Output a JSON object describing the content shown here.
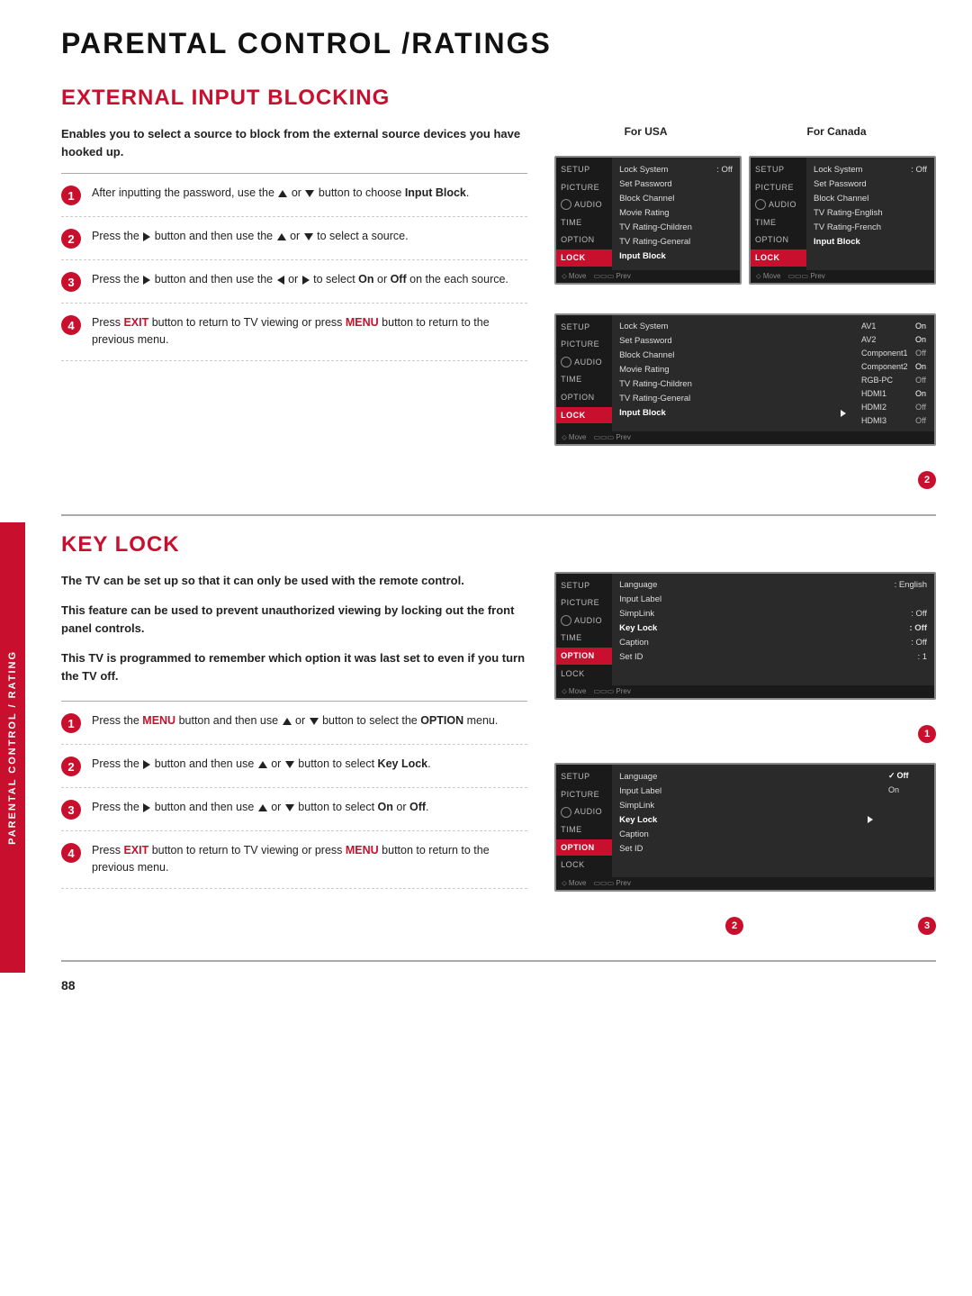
{
  "page": {
    "title": "PARENTAL CONTROL /RATINGS",
    "page_number": "88",
    "sidebar_label": "PARENTAL CONTROL / RATING"
  },
  "external_input_blocking": {
    "section_title": "EXTERNAL INPUT BLOCKING",
    "intro_text": "Enables you to select a source to block from the external source devices you have hooked up.",
    "steps": [
      {
        "num": "1",
        "text_parts": [
          "After inputting the password, use the ",
          "▲",
          " or ",
          "▼",
          " button to choose ",
          "Input Block",
          "."
        ]
      },
      {
        "num": "2",
        "text_parts": [
          "Press the ",
          "▶",
          " button and then use the ",
          "▲",
          " or ",
          "▼",
          " to select a source."
        ]
      },
      {
        "num": "3",
        "text_parts": [
          "Press the ",
          "▶",
          " button and then use the ",
          "◀",
          " or ",
          "▶",
          " to select ",
          "On",
          " or ",
          "Off",
          " on the each source."
        ]
      },
      {
        "num": "4",
        "text_parts": [
          "Press ",
          "EXIT",
          " button to return to TV viewing or press ",
          "MENU",
          " button to return to the previous menu."
        ]
      }
    ],
    "for_usa_label": "For USA",
    "for_canada_label": "For Canada",
    "menu_usa_items": [
      {
        "label": "Lock System",
        "value": ": Off"
      },
      {
        "label": "Set Password",
        "value": ""
      },
      {
        "label": "Block Channel",
        "value": ""
      },
      {
        "label": "Movie Rating",
        "value": ""
      },
      {
        "label": "TV Rating-Children",
        "value": ""
      },
      {
        "label": "TV Rating-General",
        "value": ""
      },
      {
        "label": "Input Block",
        "value": ""
      }
    ],
    "menu_canada_items": [
      {
        "label": "Lock System",
        "value": ": Off"
      },
      {
        "label": "Set Password",
        "value": ""
      },
      {
        "label": "Block Channel",
        "value": ""
      },
      {
        "label": "TV Rating-English",
        "value": ""
      },
      {
        "label": "TV Rating-French",
        "value": ""
      },
      {
        "label": "Input Block",
        "value": ""
      }
    ],
    "menu_sub_items": [
      {
        "label": "AV1",
        "value": "On",
        "state": "on"
      },
      {
        "label": "AV2",
        "value": "On",
        "state": "on"
      },
      {
        "label": "Component1",
        "value": "Off",
        "state": "off"
      },
      {
        "label": "Component2",
        "value": "On",
        "state": "on"
      },
      {
        "label": "RGB-PC",
        "value": "Off",
        "state": "off"
      },
      {
        "label": "HDMI1",
        "value": "On",
        "state": "on"
      },
      {
        "label": "HDMI2",
        "value": "Off",
        "state": "off"
      },
      {
        "label": "HDMI3",
        "value": "Off",
        "state": "off"
      }
    ],
    "menu_sidebar_items": [
      "SETUP",
      "PICTURE",
      "AUDIO",
      "TIME",
      "OPTION",
      "LOCK"
    ],
    "badge2": "2"
  },
  "key_lock": {
    "section_title": "KEY LOCK",
    "desc_lines": [
      "The TV can be set up so that it can only be used with the remote control.",
      "This feature can be used to prevent unauthorized viewing by locking out the front panel controls.",
      "This TV is programmed to remember which option it was last set to even if you turn the TV off."
    ],
    "steps": [
      {
        "num": "1",
        "text_parts": [
          "Press the ",
          "MENU",
          " button and then use ",
          "▲",
          " or ",
          "▼",
          " button to select the ",
          "OPTION",
          " menu."
        ]
      },
      {
        "num": "2",
        "text_parts": [
          "Press the ",
          "▶",
          " button and then use ",
          "▲",
          " or ",
          "▼",
          " button to select ",
          "Key Lock",
          "."
        ]
      },
      {
        "num": "3",
        "text_parts": [
          "Press the ",
          "▶",
          " button and then use ",
          "▲",
          " or ",
          "▼",
          " button to select ",
          "On",
          " or ",
          "Off",
          "."
        ]
      },
      {
        "num": "4",
        "text_parts": [
          "Press ",
          "EXIT",
          " button to return to TV viewing or press ",
          "MENU",
          " button to return to the previous menu."
        ]
      }
    ],
    "menu_option_items": [
      {
        "label": "Language",
        "value": ": English"
      },
      {
        "label": "Input Label",
        "value": ""
      },
      {
        "label": "SimpLink",
        "value": ": Off"
      },
      {
        "label": "Key Lock",
        "value": ": Off"
      },
      {
        "label": "Caption",
        "value": ": Off"
      },
      {
        "label": "Set ID",
        "value": ": 1"
      }
    ],
    "menu_keylock_items": [
      {
        "label": "Language",
        "value": ""
      },
      {
        "label": "Input Label",
        "value": ""
      },
      {
        "label": "SimpLink",
        "value": ""
      },
      {
        "label": "Key Lock",
        "value": "▶",
        "arrow": true
      },
      {
        "label": "Caption",
        "value": ""
      },
      {
        "label": "Set ID",
        "value": ""
      }
    ],
    "menu_keylock_sub": [
      {
        "label": "✓ Off",
        "value": "",
        "selected": true
      },
      {
        "label": "On",
        "value": ""
      }
    ],
    "menu_sidebar_items": [
      "SETUP",
      "PICTURE",
      "AUDIO",
      "TIME",
      "OPTION",
      "LOCK"
    ],
    "badge1": "1",
    "badge23": [
      "2",
      "3"
    ]
  }
}
